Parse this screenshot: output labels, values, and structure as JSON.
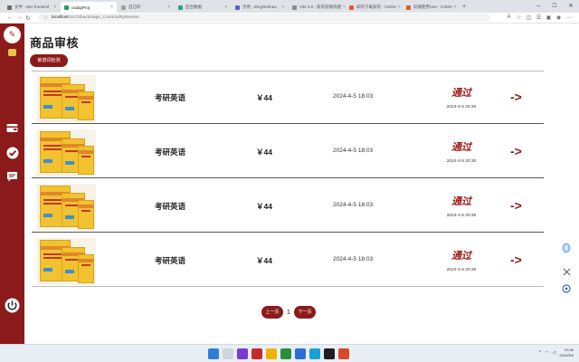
{
  "browser": {
    "tabs": [
      {
        "title": "文件 - dev-frontend",
        "color": "#6a6a6a"
      },
      {
        "title": "csdapProj",
        "color": "#2e9a5a"
      },
      {
        "title": "自己的",
        "color": "#9aa0a6"
      },
      {
        "title": "后台数据",
        "color": "#2b9f8f"
      },
      {
        "title": "示例 - BingRedraw",
        "color": "#5b5fc7"
      },
      {
        "title": "Vite 3.0 - 新的前端构建",
        "color": "#8b8b8b"
      },
      {
        "title": "如何下载安装 - CSDN",
        "color": "#e0592a"
      },
      {
        "title": "前端使用Vue - CSDN",
        "color": "#e0592a"
      }
    ],
    "active_tab_index": 1,
    "url_host": "localhost",
    "url_path": ":5173/backstage_CommodityReview"
  },
  "app": {
    "page_title": "商品审核",
    "detect_button": "敏感词检测",
    "items": [
      {
        "name": "考研英语",
        "price": "￥44",
        "time": "2024-4-5 18:03",
        "status": "通过",
        "review_time": "2024-4-5 20:30",
        "arrow": "->"
      },
      {
        "name": "考研英语",
        "price": "￥44",
        "time": "2024-4-5 18:03",
        "status": "通过",
        "review_time": "2024-4-5 20:30",
        "arrow": "->"
      },
      {
        "name": "考研英语",
        "price": "￥44",
        "time": "2024-4-5 18:03",
        "status": "通过",
        "review_time": "2024-4-5 20:30",
        "arrow": "->"
      },
      {
        "name": "考研英语",
        "price": "￥44",
        "time": "2024-4-5 18:03",
        "status": "通过",
        "review_time": "2024-4-5 20:30",
        "arrow": "->"
      }
    ],
    "pager": {
      "prev": "上一页",
      "page": "1",
      "next": "下一页"
    }
  },
  "taskbar": {
    "time": "20:46",
    "date": "2024/5/6"
  },
  "colors": {
    "accent": "#8b1a1a",
    "status": "#a01c1c"
  }
}
